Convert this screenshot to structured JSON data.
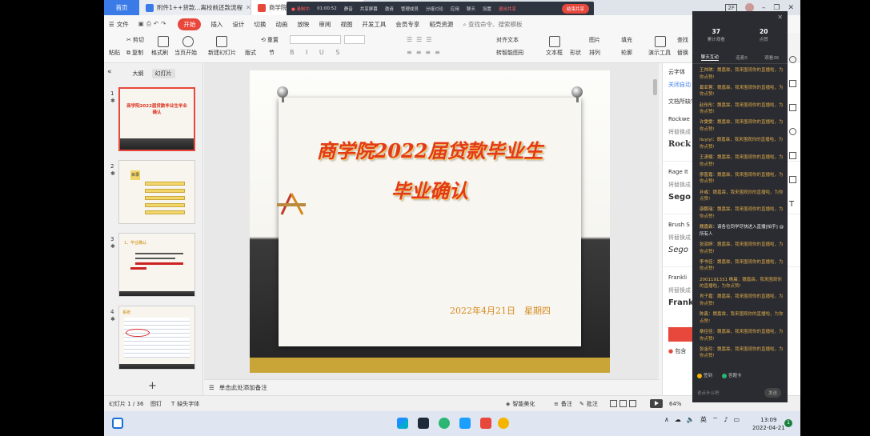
{
  "tabs": {
    "home": "首页",
    "doc": "附件1++贷款...离校前还款流程",
    "active": "商学院202"
  },
  "window": {
    "badge": "2F"
  },
  "meeting": {
    "rec": "● 录制中",
    "time": "01:00:52",
    "items": [
      "静音",
      "共享屏幕",
      "邀请",
      "管理成员",
      "分组讨论",
      "应用",
      "聊天",
      "设置"
    ],
    "leave": "退出共享",
    "end": "结束共享"
  },
  "menu": {
    "file": "文件",
    "start": "开始",
    "items": [
      "插入",
      "设计",
      "切换",
      "动画",
      "放映",
      "审阅",
      "视图",
      "开发工具",
      "会员专享",
      "稻壳资源"
    ],
    "search": "查找命令、搜索模板"
  },
  "ribbon": {
    "paste": "粘贴",
    "cut": "剪切",
    "copy": "复制",
    "format_painter": "格式刷",
    "play_from_current": "当页开始",
    "new_slide": "新建幻灯片",
    "layout": "版式",
    "section": "节",
    "reset": "重置",
    "text_direction": "对齐文本",
    "convert_smartart": "转智能图形",
    "textbox": "文本框",
    "shape": "形状",
    "arrange": "排列",
    "picture": "图片",
    "fill": "填充",
    "outline": "轮廓",
    "presenter_tools": "演示工具",
    "find": "查找",
    "replace": "替换"
  },
  "panel": {
    "tab_outline": "大纲",
    "tab_slides": "幻灯片",
    "thumb1_title": "商学院2022届贷款毕业生毕业确认",
    "thumb2_title": "目录",
    "thumb3_title": "1、毕业确认",
    "thumb4_title": "系统"
  },
  "slide": {
    "title1": "商学院2022届贷款毕业生",
    "title2": "毕业确认",
    "date": "2022年4月21日　星期四"
  },
  "notes": {
    "placeholder": "单击此处添加备注"
  },
  "sidepane": {
    "font_title": "云字体",
    "font_link": "关闭自动",
    "recommend": "文档所缺字体",
    "items": [
      {
        "name": "Rockwe",
        "replace": "将替换成",
        "sample": "Rock"
      },
      {
        "name": "Rage It",
        "replace": "将替换成",
        "sample": "Sego"
      },
      {
        "name": "Brush S",
        "replace": "将替换成",
        "sample": "Sego"
      },
      {
        "name": "Frankli",
        "replace": "将替换成",
        "sample": "Frank"
      }
    ],
    "include": "包含"
  },
  "status": {
    "slide": "幻灯片 1 / 36",
    "theme": "图钉",
    "missing_font": "缺失字体",
    "beautify": "智能美化",
    "notes": "备注",
    "comments": "批注",
    "zoom": "64%"
  },
  "taskbar": {
    "lang": "英",
    "time": "13:09",
    "date": "2022-04-21",
    "notifications": "1"
  },
  "chat": {
    "stat1_value": "37",
    "stat1_label": "累计观看",
    "stat2_value": "20",
    "stat2_label": "点赞",
    "tabs": [
      "聊天互动",
      "连麦0",
      "观看36"
    ],
    "messages": [
      {
        "who": "王帅琪",
        "text": "魏嘉霖，我来围观你的直播啦，为你点赞!"
      },
      {
        "who": "葛亚蓉",
        "text": "魏嘉霖，我来围观你的直播啦，为你点赞!"
      },
      {
        "who": "赵彤彤",
        "text": "魏嘉霖，我来围观你的直播啦，为你点赞!"
      },
      {
        "who": "许雯雯",
        "text": "魏嘉霖，我来围观你的直播啦，为你点赞!"
      },
      {
        "who": "liuyiyi",
        "text": "魏嘉霖，我来围观你的直播啦，为你点赞!"
      },
      {
        "who": "王潇楠",
        "text": "魏嘉霖，我来围观你的直播啦，为你点赞!"
      },
      {
        "who": "廖晋嘉",
        "text": "魏嘉霖，我来围观你的直播啦，为你点赞!"
      },
      {
        "who": "孙彧",
        "text": "魏嘉霖，我来围观你的直播啦，为你点赞!"
      },
      {
        "who": "康鹏瑞",
        "text": "魏嘉霖，我来围观你的直播啦，为你点赞!"
      },
      {
        "who": "魏嘉霖",
        "text": "请各位同学尽快进入直播[拍手] @所有人",
        "sys": true
      },
      {
        "who": "张润婷",
        "text": "魏嘉霖，我来围观你的直播啦，为你点赞!"
      },
      {
        "who": "李书佳",
        "text": "魏嘉霖，我来围观你的直播啦，为你点赞!"
      },
      {
        "who": "2001191331 杨晨",
        "text": "魏嘉霖，我来围观你的直播啦，为你点赞!"
      },
      {
        "who": "肖子嘉",
        "text": "魏嘉霖，我来围观你的直播啦，为你点赞!"
      },
      {
        "who": "陈鑫",
        "text": "魏嘉霖，我来围观你的直播啦，为你点赞!"
      },
      {
        "who": "桑佳佳",
        "text": "魏嘉霖，我来围观你的直播啦，为你点赞!"
      },
      {
        "who": "张金玲",
        "text": "魏嘉霖，我来围观你的直播啦，为你点赞!"
      }
    ],
    "sign": "签到",
    "like": "答题卡",
    "input": "说点什么吧",
    "send": "发送"
  },
  "colors": {
    "accent": "#e8473c",
    "title": "#e23a1a",
    "date": "#d4891e"
  }
}
